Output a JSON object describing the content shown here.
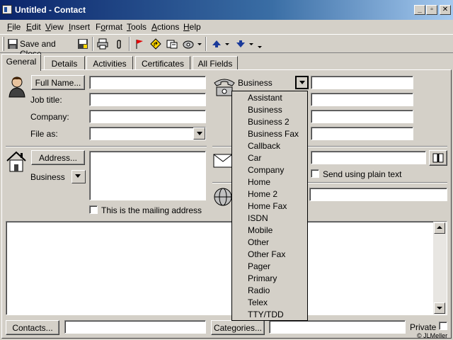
{
  "window": {
    "title": "Untitled - Contact",
    "minimize": "_",
    "maximize": "▫",
    "close": "✕"
  },
  "menu": [
    "File",
    "Edit",
    "View",
    "Insert",
    "Format",
    "Tools",
    "Actions",
    "Help"
  ],
  "menu_underline": [
    "F",
    "E",
    "V",
    "I",
    "o",
    "T",
    "A",
    "H"
  ],
  "toolbar": {
    "save_and_close": "Save and Close"
  },
  "tabs": [
    "General",
    "Details",
    "Activities",
    "Certificates",
    "All Fields"
  ],
  "general": {
    "full_name_button": "Full Name...",
    "job_title_label": "Job title:",
    "company_label": "Company:",
    "file_as_label": "File as:",
    "address_button": "Address...",
    "address_type": "Business",
    "mailing_address_label": "This is the mailing address",
    "phone_type_label": "Business",
    "send_plain_text_label": "Send using plain text",
    "contacts_button": "Contacts...",
    "categories_button": "Categories...",
    "private_label": "Private"
  },
  "phone_dropdown": {
    "options": [
      "Assistant",
      "Business",
      "Business 2",
      "Business Fax",
      "Callback",
      "Car",
      "Company",
      "Home",
      "Home 2",
      "Home Fax",
      "ISDN",
      "Mobile",
      "Other",
      "Other Fax",
      "Pager",
      "Primary",
      "Radio",
      "Telex",
      "TTY/TDD"
    ]
  },
  "watermark": "© JLMeller",
  "colors": {
    "title_start": "#0a246a",
    "title_end": "#a6caf0",
    "face": "#d4d0c8"
  }
}
